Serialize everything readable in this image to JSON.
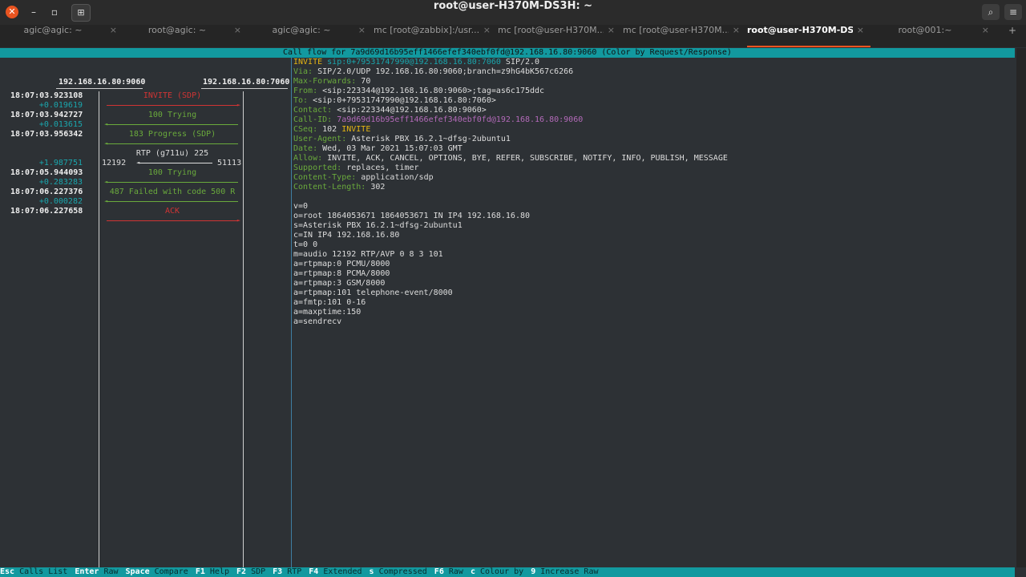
{
  "window": {
    "title": "root@user-H370M-DS3H: ~",
    "close_glyph": "✕",
    "minimize_glyph": "–",
    "maximize_glyph": "▫",
    "new_tab_glyph": "⊞",
    "search_glyph": "⌕",
    "menu_glyph": "≡",
    "tab_close_glyph": "×",
    "tab_add_glyph": "+"
  },
  "tabs": [
    {
      "label": "agic@agic: ~",
      "active": false
    },
    {
      "label": "root@agic: ~",
      "active": false
    },
    {
      "label": "agic@agic: ~",
      "active": false
    },
    {
      "label": "mc [root@zabbix]:/usr...",
      "active": false
    },
    {
      "label": "mc [root@user-H370M...",
      "active": false
    },
    {
      "label": "mc [root@user-H370M...",
      "active": false
    },
    {
      "label": "root@user-H370M-DS...",
      "active": true
    },
    {
      "label": "root@001:~",
      "active": false
    }
  ],
  "callflow": {
    "header": "Call flow for 7a9d69d16b95eff1466efef340ebf0fd@192.168.16.80:9060 (Color by Request/Response)",
    "host_a": "192.168.16.80:9060",
    "host_b": "192.168.16.80:7060",
    "arrows": {
      "right": "►",
      "left": "◄"
    },
    "rows": [
      {
        "time": "18:07:03.923108",
        "delta": "",
        "label": "INVITE (SDP)",
        "color": "red",
        "dir": "right"
      },
      {
        "time": "18:07:03.942727",
        "delta": "+0.019619",
        "label": "100 Trying",
        "color": "green",
        "dir": "left"
      },
      {
        "time": "18:07:03.956342",
        "delta": "+0.013615",
        "label": "183 Progress (SDP)",
        "color": "green",
        "dir": "left"
      },
      {
        "time": "",
        "delta": "",
        "label": "RTP (g711u) 225",
        "color": "white",
        "dir": "left",
        "rtp": true,
        "port_a": "12192",
        "port_b": "51113"
      },
      {
        "time": "18:07:05.944093",
        "delta": "+1.987751",
        "label": "100 Trying",
        "color": "green",
        "dir": "left"
      },
      {
        "time": "18:07:06.227376",
        "delta": "+0.283283",
        "label": "487 Failed with code 500 R",
        "color": "green",
        "dir": "left"
      },
      {
        "time": "18:07:06.227658",
        "delta": "+0.000282",
        "label": "ACK",
        "color": "red",
        "dir": "right"
      }
    ]
  },
  "sip_message": {
    "lines": [
      [
        {
          "t": "INVITE ",
          "c": "yel"
        },
        {
          "t": "sip:0+79531747990@192.168.16.80:7060",
          "c": "cy"
        },
        {
          "t": " SIP/2.0",
          "c": ""
        }
      ],
      [
        {
          "t": "Via: ",
          "c": "hn"
        },
        {
          "t": "SIP/2.0/UDP 192.168.16.80:9060;branch=z9hG4bK567c6266",
          "c": ""
        }
      ],
      [
        {
          "t": "Max-Forwards: ",
          "c": "hn"
        },
        {
          "t": "70",
          "c": ""
        }
      ],
      [
        {
          "t": "From: ",
          "c": "hn"
        },
        {
          "t": "<sip:223344@192.168.16.80:9060>;tag=as6c175ddc",
          "c": ""
        }
      ],
      [
        {
          "t": "To: ",
          "c": "hn"
        },
        {
          "t": "<sip:0+79531747990@192.168.16.80:7060>",
          "c": ""
        }
      ],
      [
        {
          "t": "Contact: ",
          "c": "hn"
        },
        {
          "t": "<sip:223344@192.168.16.80:9060>",
          "c": ""
        }
      ],
      [
        {
          "t": "Call-ID: ",
          "c": "hn"
        },
        {
          "t": "7a9d69d16b95eff1466efef340ebf0fd@192.168.16.80:9060",
          "c": "mag"
        }
      ],
      [
        {
          "t": "CSeq: ",
          "c": "hn"
        },
        {
          "t": "102 ",
          "c": ""
        },
        {
          "t": "INVITE",
          "c": "yel"
        }
      ],
      [
        {
          "t": "User-Agent: ",
          "c": "hn"
        },
        {
          "t": "Asterisk PBX 16.2.1~dfsg-2ubuntu1",
          "c": ""
        }
      ],
      [
        {
          "t": "Date: ",
          "c": "hn"
        },
        {
          "t": "Wed, 03 Mar 2021 15:07:03 GMT",
          "c": ""
        }
      ],
      [
        {
          "t": "Allow: ",
          "c": "hn"
        },
        {
          "t": "INVITE, ACK, CANCEL, OPTIONS, BYE, REFER, SUBSCRIBE, NOTIFY, INFO, PUBLISH, MESSAGE",
          "c": ""
        }
      ],
      [
        {
          "t": "Supported: ",
          "c": "hn"
        },
        {
          "t": "replaces, timer",
          "c": ""
        }
      ],
      [
        {
          "t": "Content-Type: ",
          "c": "hn"
        },
        {
          "t": "application/sdp",
          "c": ""
        }
      ],
      [
        {
          "t": "Content-Length: ",
          "c": "hn"
        },
        {
          "t": "302",
          "c": ""
        }
      ],
      [
        {
          "t": "",
          "c": ""
        }
      ],
      [
        {
          "t": "v=0",
          "c": ""
        }
      ],
      [
        {
          "t": "o=root 1864053671 1864053671 IN IP4 192.168.16.80",
          "c": ""
        }
      ],
      [
        {
          "t": "s=Asterisk PBX 16.2.1~dfsg-2ubuntu1",
          "c": ""
        }
      ],
      [
        {
          "t": "c=IN IP4 192.168.16.80",
          "c": ""
        }
      ],
      [
        {
          "t": "t=0 0",
          "c": ""
        }
      ],
      [
        {
          "t": "m=audio 12192 RTP/AVP 0 8 3 101",
          "c": ""
        }
      ],
      [
        {
          "t": "a=rtpmap:0 PCMU/8000",
          "c": ""
        }
      ],
      [
        {
          "t": "a=rtpmap:8 PCMA/8000",
          "c": ""
        }
      ],
      [
        {
          "t": "a=rtpmap:3 GSM/8000",
          "c": ""
        }
      ],
      [
        {
          "t": "a=rtpmap:101 telephone-event/8000",
          "c": ""
        }
      ],
      [
        {
          "t": "a=fmtp:101 0-16",
          "c": ""
        }
      ],
      [
        {
          "t": "a=maxptime:150",
          "c": ""
        }
      ],
      [
        {
          "t": "a=sendrecv",
          "c": ""
        }
      ]
    ]
  },
  "footer": [
    {
      "key": "Esc",
      "action": "Calls List"
    },
    {
      "key": "Enter",
      "action": "Raw"
    },
    {
      "key": "Space",
      "action": "Compare"
    },
    {
      "key": "F1",
      "action": "Help"
    },
    {
      "key": "F2",
      "action": "SDP"
    },
    {
      "key": "F3",
      "action": "RTP"
    },
    {
      "key": "F4",
      "action": "Extended"
    },
    {
      "key": "s",
      "action": "Compressed"
    },
    {
      "key": "F6",
      "action": "Raw"
    },
    {
      "key": "c",
      "action": "Colour by"
    },
    {
      "key": "9",
      "action": "Increase Raw"
    }
  ]
}
